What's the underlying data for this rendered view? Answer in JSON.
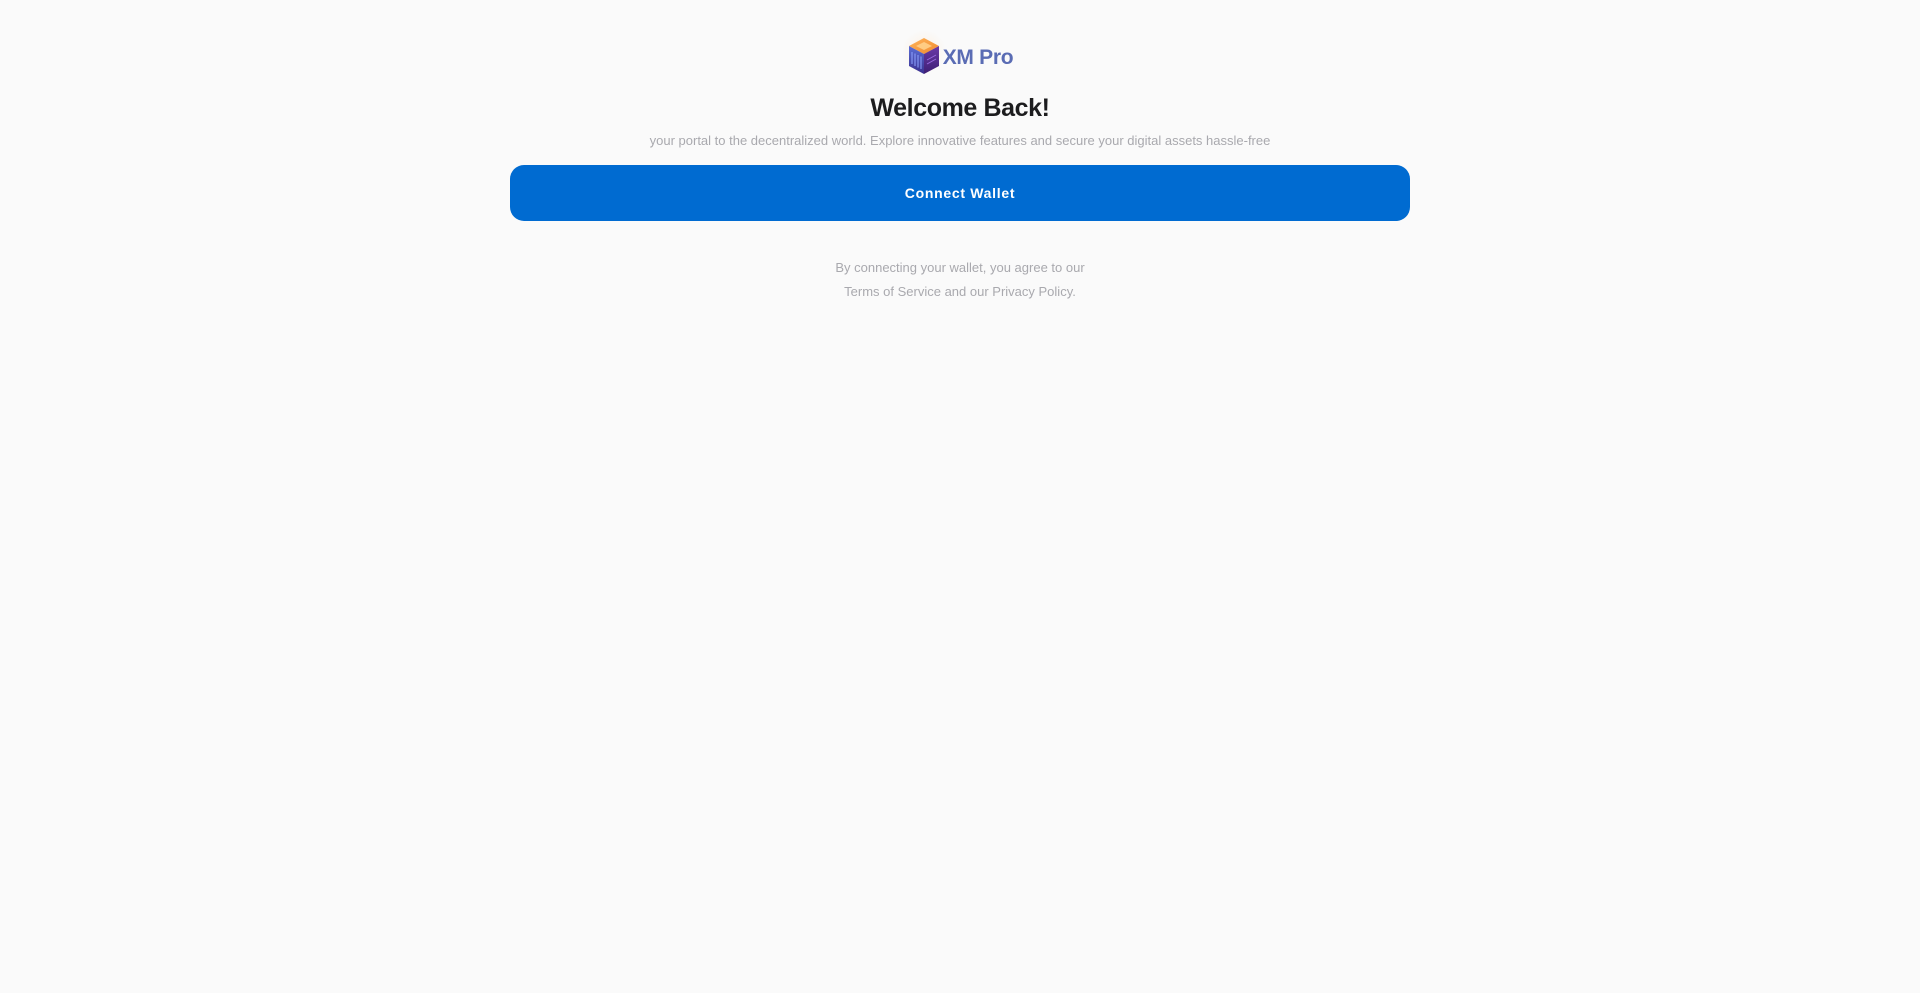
{
  "brand": {
    "name": "XM Pro",
    "logo_icon": "hexagon-cube-logo-icon"
  },
  "welcome": {
    "title": "Welcome Back!",
    "subtitle": "your portal to the decentralized world. Explore innovative features and secure your digital assets hassle-free"
  },
  "actions": {
    "connect_label": "Connect Wallet"
  },
  "agreement": {
    "line1": "By connecting your wallet, you agree to our",
    "terms_label": "Terms of Service",
    "and_text": " and our ",
    "privacy_label": "Privacy Policy",
    "end_punct": "."
  },
  "colors": {
    "background": "#fafafa",
    "primary_button": "#006bd1",
    "brand_text": "#5a6cb4",
    "title_text": "#1c1c1e",
    "muted_text": "#a9a9ae"
  }
}
